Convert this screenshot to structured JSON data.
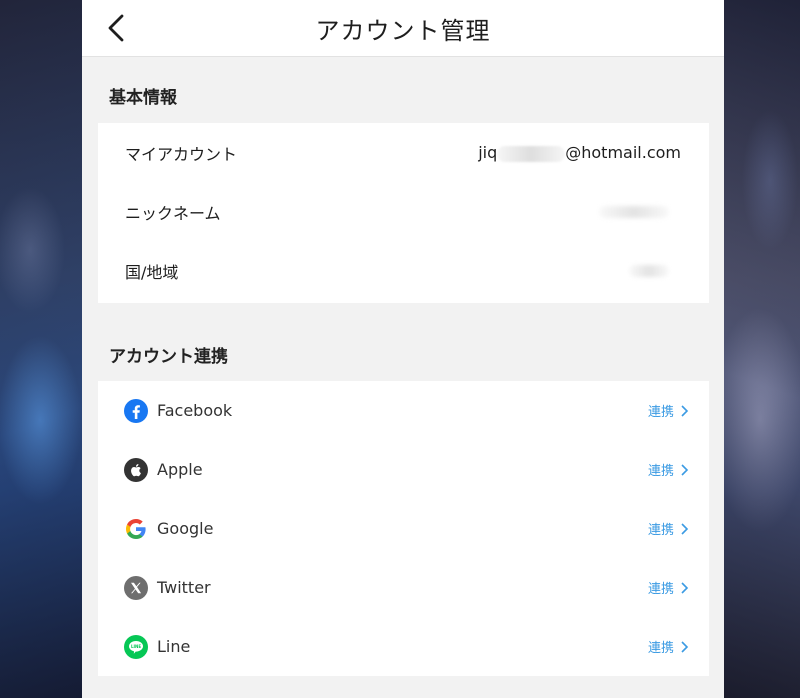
{
  "header": {
    "title": "アカウント管理",
    "back_icon": "chevron-left-icon"
  },
  "basic_info": {
    "section_title": "基本情報",
    "rows": [
      {
        "label": "マイアカウント",
        "value_prefix": "jiq",
        "value_suffix": "@hotmail.com"
      },
      {
        "label": "ニックネーム"
      },
      {
        "label": "国/地域"
      }
    ]
  },
  "linking": {
    "section_title": "アカウント連携",
    "items": [
      {
        "label": "Facebook",
        "icon": "facebook-icon",
        "action": "連携",
        "color": "#1877f2"
      },
      {
        "label": "Apple",
        "icon": "apple-icon",
        "action": "連携",
        "color": "#333333"
      },
      {
        "label": "Google",
        "icon": "google-icon",
        "action": "連携",
        "color": "#4285f4"
      },
      {
        "label": "Twitter",
        "icon": "x-icon",
        "action": "連携",
        "color": "#6e6e6e"
      },
      {
        "label": "Line",
        "icon": "line-icon",
        "action": "連携",
        "color": "#06c755"
      }
    ]
  },
  "colors": {
    "accent": "#3b9be3",
    "panel_background": "#f2f2f2",
    "card_background": "#ffffff"
  }
}
